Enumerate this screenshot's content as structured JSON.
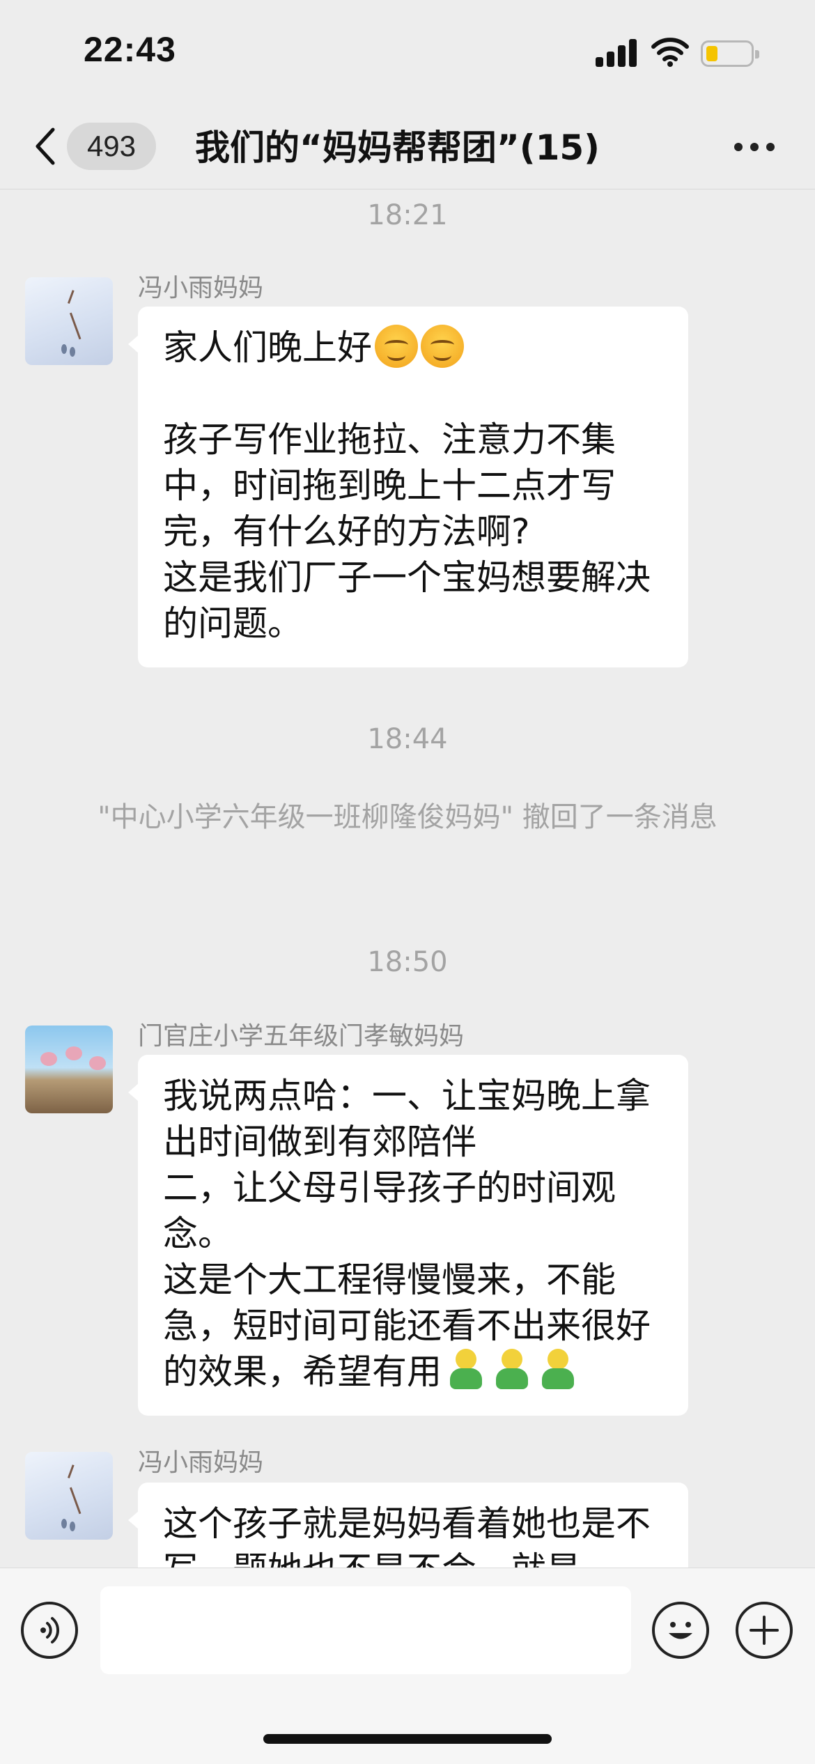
{
  "status_bar": {
    "time": "22:43",
    "battery_level": 0.25,
    "battery_color": "#f5c400"
  },
  "nav": {
    "unread_count": "493",
    "title": "我们的“妈妈帮帮团”(15)",
    "back_icon": "chevron-left-icon",
    "more_icon": "ellipsis-icon"
  },
  "messages": [
    {
      "type": "time",
      "text": "18:21"
    },
    {
      "type": "message",
      "sender": "冯小雨妈妈",
      "avatar": "snow-avatar",
      "text_line1": "家人们晚上好",
      "emojis": [
        "smiling-face-icon",
        "smiling-face-icon"
      ],
      "text_rest": "孩子写作业拖拉、注意力不集中，时间拖到晚上十二点才写完，有什么好的方法啊?\n这是我们厂子一个宝妈想要解决的问题。"
    },
    {
      "type": "time",
      "text": "18:44"
    },
    {
      "type": "system",
      "text": "\"中心小学六年级一班柳隆俊妈妈\" 撤回了一条消息"
    },
    {
      "type": "time",
      "text": "18:50"
    },
    {
      "type": "message",
      "sender": "门官庄小学五年级门孝敏妈妈",
      "avatar": "flower-avatar",
      "text": "我说两点哈：一、让宝妈晚上拿出时间做到有郊陪伴\n二，让父母引导孩子的时间观念。\n这是个大工程得慢慢来，不能急，短时间可能还看不出来很好的效果，希望有用",
      "emojis": [
        "person-icon",
        "person-icon",
        "person-icon"
      ]
    },
    {
      "type": "message",
      "sender": "冯小雨妈妈",
      "avatar": "snow-avatar",
      "text": "这个孩子就是妈妈看着她也是不写，题她也不是不会，就是"
    }
  ],
  "input_bar": {
    "voice_icon": "voice-icon",
    "emoji_icon": "emoji-icon",
    "plus_icon": "plus-icon"
  }
}
